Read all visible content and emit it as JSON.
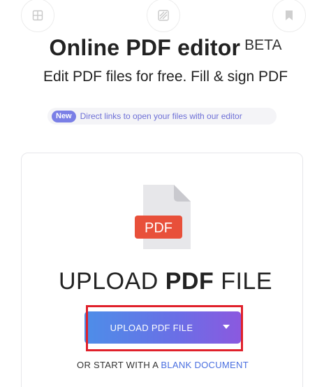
{
  "top_icons": [
    {
      "name": "grid-icon"
    },
    {
      "name": "stripes-icon"
    },
    {
      "name": "bookmark-icon"
    }
  ],
  "header": {
    "title": "Online PDF editor",
    "beta": "BETA",
    "subtitle": "Edit PDF files for free. Fill & sign PDF"
  },
  "banner": {
    "badge": "New",
    "text": "Direct links to open your files with our editor"
  },
  "upload": {
    "icon_label": "PDF",
    "heading_pre": "UPLOAD ",
    "heading_bold": "PDF",
    "heading_post": " FILE",
    "button_label": "UPLOAD PDF FILE",
    "alt_prefix": "OR START WITH A ",
    "alt_link": "BLANK DOCUMENT"
  },
  "colors": {
    "accent": "#6b6ee6",
    "highlight": "#e0202a",
    "pdf_badge": "#e8503a"
  }
}
